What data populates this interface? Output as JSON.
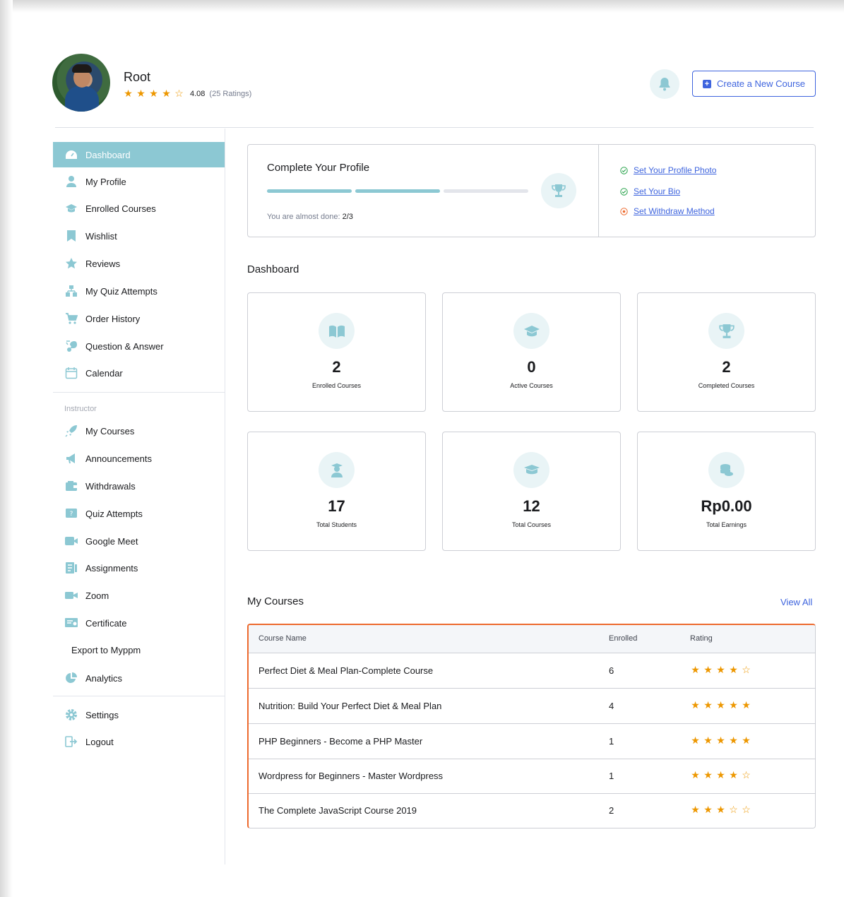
{
  "user": {
    "name": "Root",
    "rating_stars": [
      "★",
      "★",
      "★",
      "★",
      "☆"
    ],
    "rating_value": "4.08",
    "rating_count": "(25 Ratings)"
  },
  "header": {
    "create_course_label": "Create a New Course"
  },
  "sidebar": {
    "items": [
      {
        "label": "Dashboard",
        "icon": "dashboard-icon"
      },
      {
        "label": "My Profile",
        "icon": "user-icon"
      },
      {
        "label": "Enrolled Courses",
        "icon": "graduation-cap-icon"
      },
      {
        "label": "Wishlist",
        "icon": "bookmark-icon"
      },
      {
        "label": "Reviews",
        "icon": "star-icon"
      },
      {
        "label": "My Quiz Attempts",
        "icon": "quiz-icon"
      },
      {
        "label": "Order History",
        "icon": "cart-icon"
      },
      {
        "label": "Question & Answer",
        "icon": "qa-icon"
      },
      {
        "label": "Calendar",
        "icon": "calendar-icon"
      }
    ],
    "instructor_heading": "Instructor",
    "instructor_items": [
      {
        "label": "My Courses",
        "icon": "rocket-icon"
      },
      {
        "label": "Announcements",
        "icon": "megaphone-icon"
      },
      {
        "label": "Withdrawals",
        "icon": "wallet-icon"
      },
      {
        "label": "Quiz Attempts",
        "icon": "quiz-attempts-icon"
      },
      {
        "label": "Google Meet",
        "icon": "video-icon"
      },
      {
        "label": "Assignments",
        "icon": "assignment-icon"
      },
      {
        "label": "Zoom",
        "icon": "zoom-icon"
      },
      {
        "label": "Certificate",
        "icon": "certificate-icon"
      },
      {
        "label": "Export to Myppm",
        "icon": ""
      },
      {
        "label": "Analytics",
        "icon": "pie-chart-icon"
      }
    ],
    "bottom_items": [
      {
        "label": "Settings",
        "icon": "gear-icon"
      },
      {
        "label": "Logout",
        "icon": "logout-icon"
      }
    ]
  },
  "profile_completion": {
    "title": "Complete Your Profile",
    "progress": "2/3",
    "note_prefix": "You are almost done:",
    "note_value": "2/3",
    "links": [
      {
        "label": "Set Your Profile Photo",
        "status": "done"
      },
      {
        "label": "Set Your Bio",
        "status": "done"
      },
      {
        "label": "Set Withdraw Method",
        "status": "pending"
      }
    ]
  },
  "dashboard": {
    "title": "Dashboard",
    "stats": [
      {
        "value": "2",
        "label": "Enrolled Courses",
        "icon": "open-book-icon"
      },
      {
        "value": "0",
        "label": "Active Courses",
        "icon": "graduation-cap-icon"
      },
      {
        "value": "2",
        "label": "Completed Courses",
        "icon": "trophy-icon"
      },
      {
        "value": "17",
        "label": "Total Students",
        "icon": "student-icon"
      },
      {
        "value": "12",
        "label": "Total Courses",
        "icon": "courses-icon"
      },
      {
        "value": "Rp0.00",
        "label": "Total Earnings",
        "icon": "coins-icon"
      }
    ]
  },
  "my_courses": {
    "title": "My Courses",
    "view_all": "View All",
    "columns": [
      "Course Name",
      "Enrolled",
      "Rating"
    ],
    "rows": [
      {
        "name": "Perfect Diet & Meal Plan-Complete Course",
        "enrolled": "6",
        "stars": [
          "★",
          "★",
          "★",
          "★",
          "☆"
        ]
      },
      {
        "name": "Nutrition: Build Your Perfect Diet & Meal Plan",
        "enrolled": "4",
        "stars": [
          "★",
          "★",
          "★",
          "★",
          "★"
        ]
      },
      {
        "name": "PHP Beginners - Become a PHP Master",
        "enrolled": "1",
        "stars": [
          "★",
          "★",
          "★",
          "★",
          "★"
        ]
      },
      {
        "name": "Wordpress for Beginners - Master Wordpress",
        "enrolled": "1",
        "stars": [
          "★",
          "★",
          "★",
          "★",
          "☆"
        ]
      },
      {
        "name": "The Complete JavaScript Course 2019",
        "enrolled": "2",
        "stars": [
          "★",
          "★",
          "★",
          "☆",
          "☆"
        ]
      }
    ]
  },
  "colors": {
    "accent": "#8cc8d3",
    "link": "#3e64de",
    "star": "#ed9700",
    "done": "#24a148",
    "pending": "#ed6a2e"
  }
}
